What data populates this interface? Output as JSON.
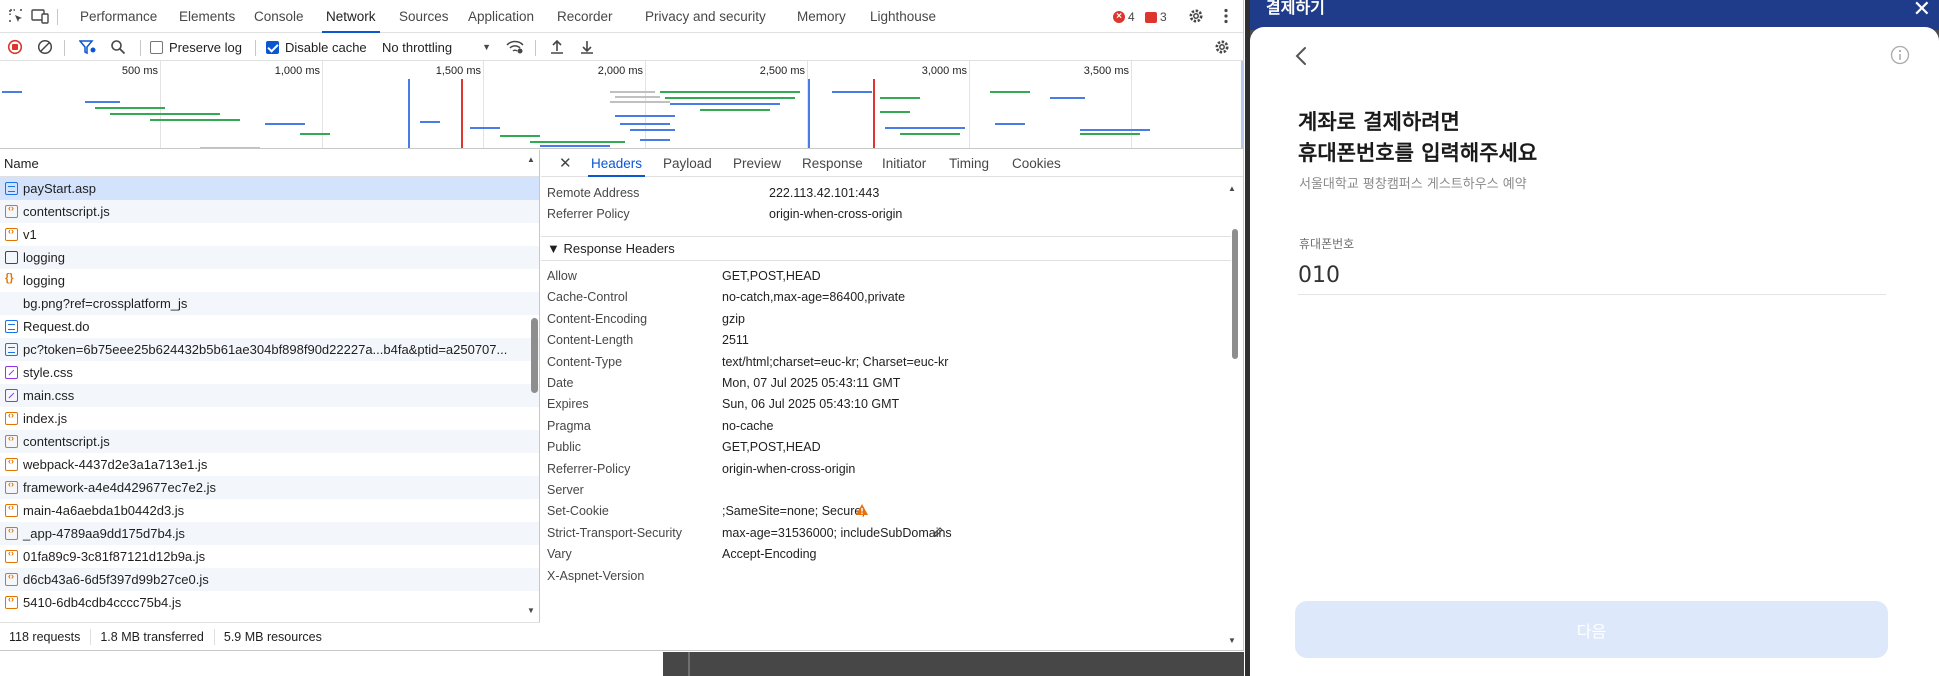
{
  "devtools": {
    "tabs": [
      "Performance",
      "Elements",
      "Console",
      "Network",
      "Sources",
      "Application",
      "Recorder",
      "Privacy and security",
      "Memory",
      "Lighthouse"
    ],
    "active_tab": "Network",
    "errors_count": "4",
    "issues_count": "3",
    "toolbar": {
      "preserve_log": "Preserve log",
      "disable_cache": "Disable cache",
      "throttling": "No throttling"
    },
    "overview": {
      "ticks": [
        "500 ms",
        "1,000 ms",
        "1,500 ms",
        "2,000 ms",
        "2,500 ms",
        "3,000 ms",
        "3,500 ms"
      ]
    },
    "request_list": {
      "header": "Name",
      "rows": [
        {
          "name": "payStart.asp",
          "type": "doc"
        },
        {
          "name": "contentscript.js",
          "type": "script"
        },
        {
          "name": "v1",
          "type": "script"
        },
        {
          "name": "logging",
          "type": "xhr"
        },
        {
          "name": "logging",
          "type": "fetch"
        },
        {
          "name": "bg.png?ref=crossplatform_js",
          "type": "img"
        },
        {
          "name": "Request.do",
          "type": "doc"
        },
        {
          "name": "pc?token=6b75eee25b624432b5b61ae304bf898f90d22227a...b4fa&ptid=a250707...",
          "type": "doc"
        },
        {
          "name": "style.css",
          "type": "css"
        },
        {
          "name": "main.css",
          "type": "css"
        },
        {
          "name": "index.js",
          "type": "script"
        },
        {
          "name": "contentscript.js",
          "type": "script"
        },
        {
          "name": "webpack-4437d2e3a1a713e1.js",
          "type": "script"
        },
        {
          "name": "framework-a4e4d429677ec7e2.js",
          "type": "script"
        },
        {
          "name": "main-4a6aebda1b0442d3.js",
          "type": "script"
        },
        {
          "name": "_app-4789aa9dd175d7b4.js",
          "type": "script"
        },
        {
          "name": "01fa89c9-3c81f87121d12b9a.js",
          "type": "script"
        },
        {
          "name": "d6cb43a6-6d5f397d99b27ce0.js",
          "type": "script"
        },
        {
          "name": "5410-6db4cdb4cccc75b4.js",
          "type": "script"
        }
      ]
    },
    "detail_tabs": [
      "Headers",
      "Payload",
      "Preview",
      "Response",
      "Initiator",
      "Timing",
      "Cookies"
    ],
    "active_detail_tab": "Headers",
    "general": [
      {
        "name": "Remote Address",
        "value": "222.113.42.101:443"
      },
      {
        "name": "Referrer Policy",
        "value": "origin-when-cross-origin"
      }
    ],
    "response_headers_title": "▼ Response Headers",
    "response_headers": [
      {
        "name": "Allow",
        "value": "GET,POST,HEAD"
      },
      {
        "name": "Cache-Control",
        "value": "no-catch,max-age=86400,private"
      },
      {
        "name": "Content-Encoding",
        "value": "gzip"
      },
      {
        "name": "Content-Length",
        "value": "2511"
      },
      {
        "name": "Content-Type",
        "value": "text/html;charset=euc-kr; Charset=euc-kr"
      },
      {
        "name": "Date",
        "value": "Mon, 07 Jul 2025 05:43:11 GMT"
      },
      {
        "name": "Expires",
        "value": "Sun, 06 Jul 2025 05:43:10 GMT"
      },
      {
        "name": "Pragma",
        "value": "no-cache"
      },
      {
        "name": "Public",
        "value": "GET,POST,HEAD"
      },
      {
        "name": "Referrer-Policy",
        "value": "origin-when-cross-origin"
      },
      {
        "name": "Server",
        "value": ""
      },
      {
        "name": "Set-Cookie",
        "value": ";SameSite=none; Secure;"
      },
      {
        "name": "Strict-Transport-Security",
        "value": "max-age=31536000; includeSubDomains"
      },
      {
        "name": "Vary",
        "value": "Accept-Encoding"
      },
      {
        "name": "X-Aspnet-Version",
        "value": ""
      }
    ],
    "status": {
      "requests": "118 requests",
      "transferred": "1.8 MB transferred",
      "resources": "5.9 MB resources"
    }
  },
  "payment": {
    "header_title": "결제하기",
    "headline_line1": "계좌로 결제하려면",
    "headline_line2": "휴대폰번호를 입력해주세요",
    "subtitle": "서울대학교 평창캠퍼스 게스트하우스 예약",
    "phone_label": "휴대폰번호",
    "phone_value": "010",
    "next_button": "다음"
  },
  "colors": {
    "accent": "#0b57d0",
    "error": "#dc362e",
    "modal_header": "#1f3c8a",
    "next_disabled": "#dde9fb"
  }
}
